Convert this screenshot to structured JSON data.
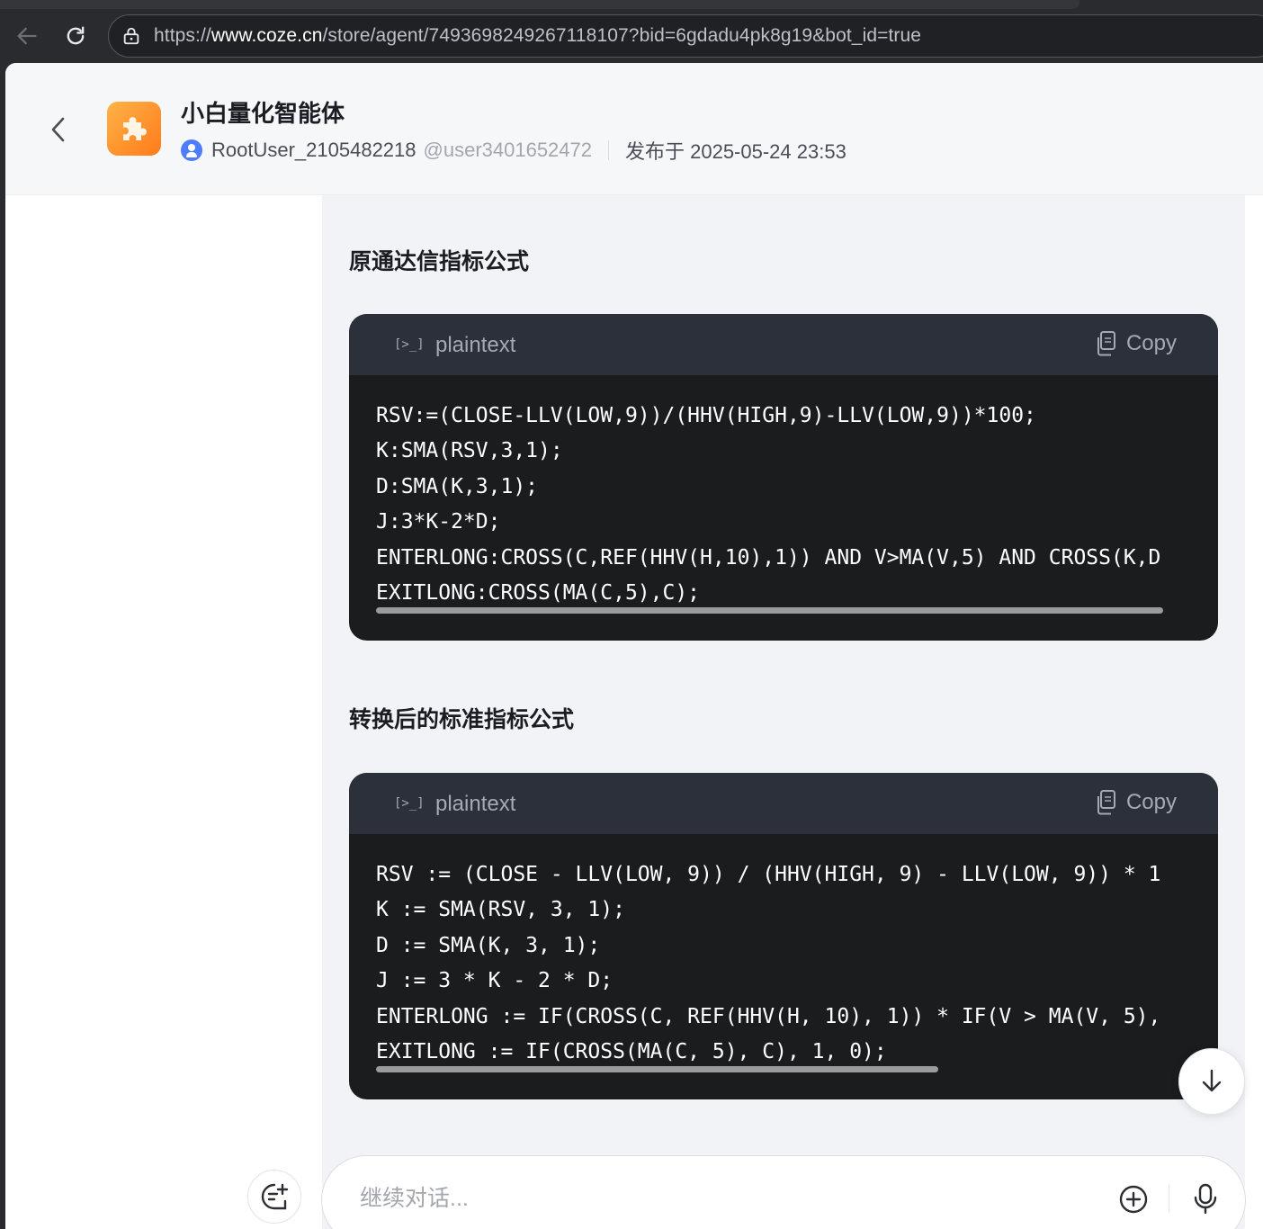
{
  "browser": {
    "url_prefix": "https://",
    "url_host": "www.coze.cn",
    "url_path": "/store/agent/7493698249267118107?bid=6gdadu4pk8g19&bot_id=true"
  },
  "header": {
    "bot_name": "小白量化智能体",
    "author_name": "RootUser_2105482218",
    "author_handle": "@user3401652472",
    "published": "发布于 2025-05-24 23:53"
  },
  "sections": [
    {
      "title": "原通达信指标公式",
      "code": {
        "lang_icon": "[>_]",
        "lang": "plaintext",
        "copy_label": "Copy",
        "lines": [
          "RSV:=(CLOSE-LLV(LOW,9))/(HHV(HIGH,9)-LLV(LOW,9))*100;",
          "K:SMA(RSV,3,1);",
          "D:SMA(K,3,1);",
          "J:3*K-2*D;",
          "ENTERLONG:CROSS(C,REF(HHV(H,10),1)) AND V>MA(V,5) AND CROSS(K,D",
          "EXITLONG:CROSS(MA(C,5),C);"
        ],
        "scroll_fraction": 0.9
      }
    },
    {
      "title": "转换后的标准指标公式",
      "code": {
        "lang_icon": "[>_]",
        "lang": "plaintext",
        "copy_label": "Copy",
        "lines": [
          "RSV := (CLOSE - LLV(LOW, 9)) / (HHV(HIGH, 9) - LLV(LOW, 9)) * 1",
          "K := SMA(RSV, 3, 1);",
          "D := SMA(K, 3, 1);",
          "J := 3 * K - 2 * D;",
          "ENTERLONG := IF(CROSS(C, REF(HHV(H, 10), 1)) * IF(V > MA(V, 5),",
          "EXITLONG := IF(CROSS(MA(C, 5), C), 1, 0);"
        ],
        "scroll_fraction": 0.64
      }
    }
  ],
  "composer": {
    "placeholder": "继续对话..."
  },
  "icons": {
    "back": "arrow-left-icon",
    "reload": "reload-icon",
    "lock": "lock-icon",
    "bot_avatar": "puzzle-icon",
    "copy": "copy-icon",
    "scroll_down": "arrow-down-icon",
    "new_chat": "new-chat-icon",
    "add": "plus-circle-icon",
    "mic": "microphone-icon"
  },
  "colors": {
    "accent": "#4d7cff",
    "bot_avatar": "#ff8a2b",
    "code_bg": "#1b1c1e",
    "code_header_bg": "#2c303a"
  }
}
